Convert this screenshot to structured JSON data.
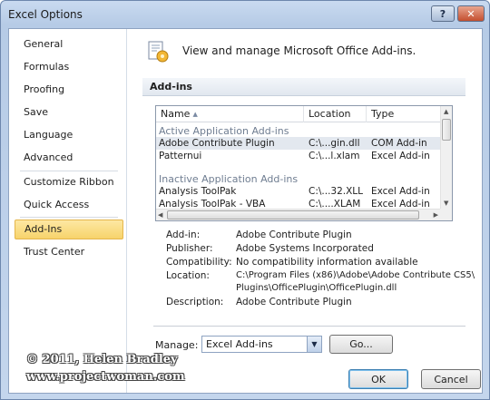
{
  "window": {
    "title": "Excel Options"
  },
  "sidebar": {
    "items": [
      {
        "label": "General"
      },
      {
        "label": "Formulas"
      },
      {
        "label": "Proofing"
      },
      {
        "label": "Save"
      },
      {
        "label": "Language"
      },
      {
        "label": "Advanced"
      },
      {
        "label": "Customize Ribbon"
      },
      {
        "label": "Quick Access Toolbar"
      },
      {
        "label": "Add-Ins"
      },
      {
        "label": "Trust Center"
      }
    ],
    "active": "Add-Ins"
  },
  "main": {
    "header_text": "View and manage Microsoft Office Add-ins.",
    "section_label": "Add-ins"
  },
  "addins_list": {
    "columns": {
      "name": "Name",
      "location": "Location",
      "type": "Type"
    },
    "groups": [
      {
        "label": "Active Application Add-ins",
        "rows": [
          {
            "name": "Adobe Contribute Plugin",
            "location": "C:\\...gin.dll",
            "type": "COM Add-in",
            "selected": true
          },
          {
            "name": "Patternui",
            "location": "C:\\...l.xlam",
            "type": "Excel Add-in"
          }
        ]
      },
      {
        "label": "Inactive Application Add-ins",
        "rows": [
          {
            "name": "Analysis ToolPak",
            "location": "C:\\...32.XLL",
            "type": "Excel Add-in"
          },
          {
            "name": "Analysis ToolPak - VBA",
            "location": "C:\\....XLAM",
            "type": "Excel Add-in"
          }
        ]
      }
    ]
  },
  "details": {
    "addin_label": "Add-in:",
    "addin_value": "Adobe Contribute Plugin",
    "publisher_label": "Publisher:",
    "publisher_value": "Adobe Systems Incorporated",
    "compat_label": "Compatibility:",
    "compat_value": "No compatibility information available",
    "location_label": "Location:",
    "location_value_1": "C:\\Program Files (x86)\\Adobe\\Adobe Contribute CS5\\",
    "location_value_2": "Plugins\\OfficePlugin\\OfficePlugin.dll",
    "description_label": "Description:",
    "description_value": "Adobe Contribute Plugin"
  },
  "manage": {
    "label": "Manage:",
    "selected": "Excel Add-ins",
    "go_label": "Go..."
  },
  "buttons": {
    "ok": "OK",
    "cancel": "Cancel"
  },
  "watermark": {
    "line1": "© 2011, Helen Bradley",
    "line2": "www.projectwoman.com"
  }
}
